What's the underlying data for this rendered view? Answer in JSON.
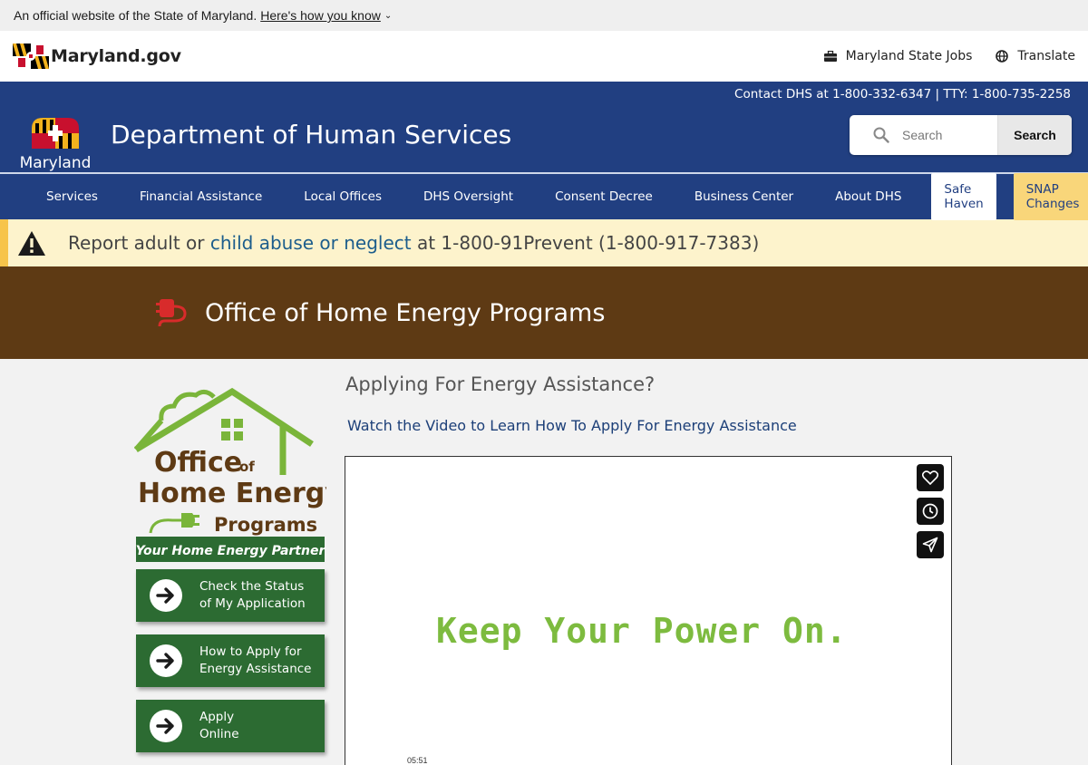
{
  "official_banner": {
    "text": "An official website of the State of Maryland.",
    "link": "Here's how you know"
  },
  "mdgov": {
    "wordmark": "Maryland.gov",
    "links": [
      {
        "label": "Maryland State Jobs",
        "icon": "briefcase-icon"
      },
      {
        "label": "Translate",
        "icon": "globe-icon"
      }
    ]
  },
  "dhs": {
    "contact": "Contact DHS at 1-800-332-6347 | TTY: 1-800-735-2258",
    "logo_word": "Maryland",
    "title": "Department of Human Services",
    "search": {
      "placeholder": "Search",
      "button": "Search"
    }
  },
  "nav": {
    "items": [
      "Services",
      "Financial Assistance",
      "Local Offices",
      "DHS Oversight",
      "Consent Decree",
      "Business Center",
      "About DHS"
    ],
    "safe_haven": "Safe Haven",
    "snap": "SNAP Changes"
  },
  "alert": {
    "before": "Report adult or ",
    "link": "child abuse or neglect",
    "after": " at 1-800-91Prevent (1-800-917-7383)"
  },
  "office": {
    "title": "Office of Home Energy Programs"
  },
  "sidebar": {
    "logo": {
      "line1": "Office",
      "line1b": "of",
      "line2": "Home Energy",
      "line3": "Programs",
      "tagline": "Your Home Energy Partner"
    },
    "buttons": [
      {
        "line1": "Check the Status",
        "line2": "of My Application"
      },
      {
        "line1": "How to Apply for",
        "line2": "Energy Assistance"
      },
      {
        "line1": "Apply",
        "line2": "Online"
      }
    ]
  },
  "content": {
    "heading": "Applying For Energy Assistance?",
    "video_link": "Watch the Video to Learn How To Apply For Energy Assistance",
    "video_text": "Keep Your Power On.",
    "video_time": "05:51"
  },
  "colors": {
    "navy": "#213f81",
    "brown": "#5e3a14",
    "green": "#2c6b32",
    "alert_bg": "#fdf3cc",
    "snap_bg": "#f9d67a"
  }
}
